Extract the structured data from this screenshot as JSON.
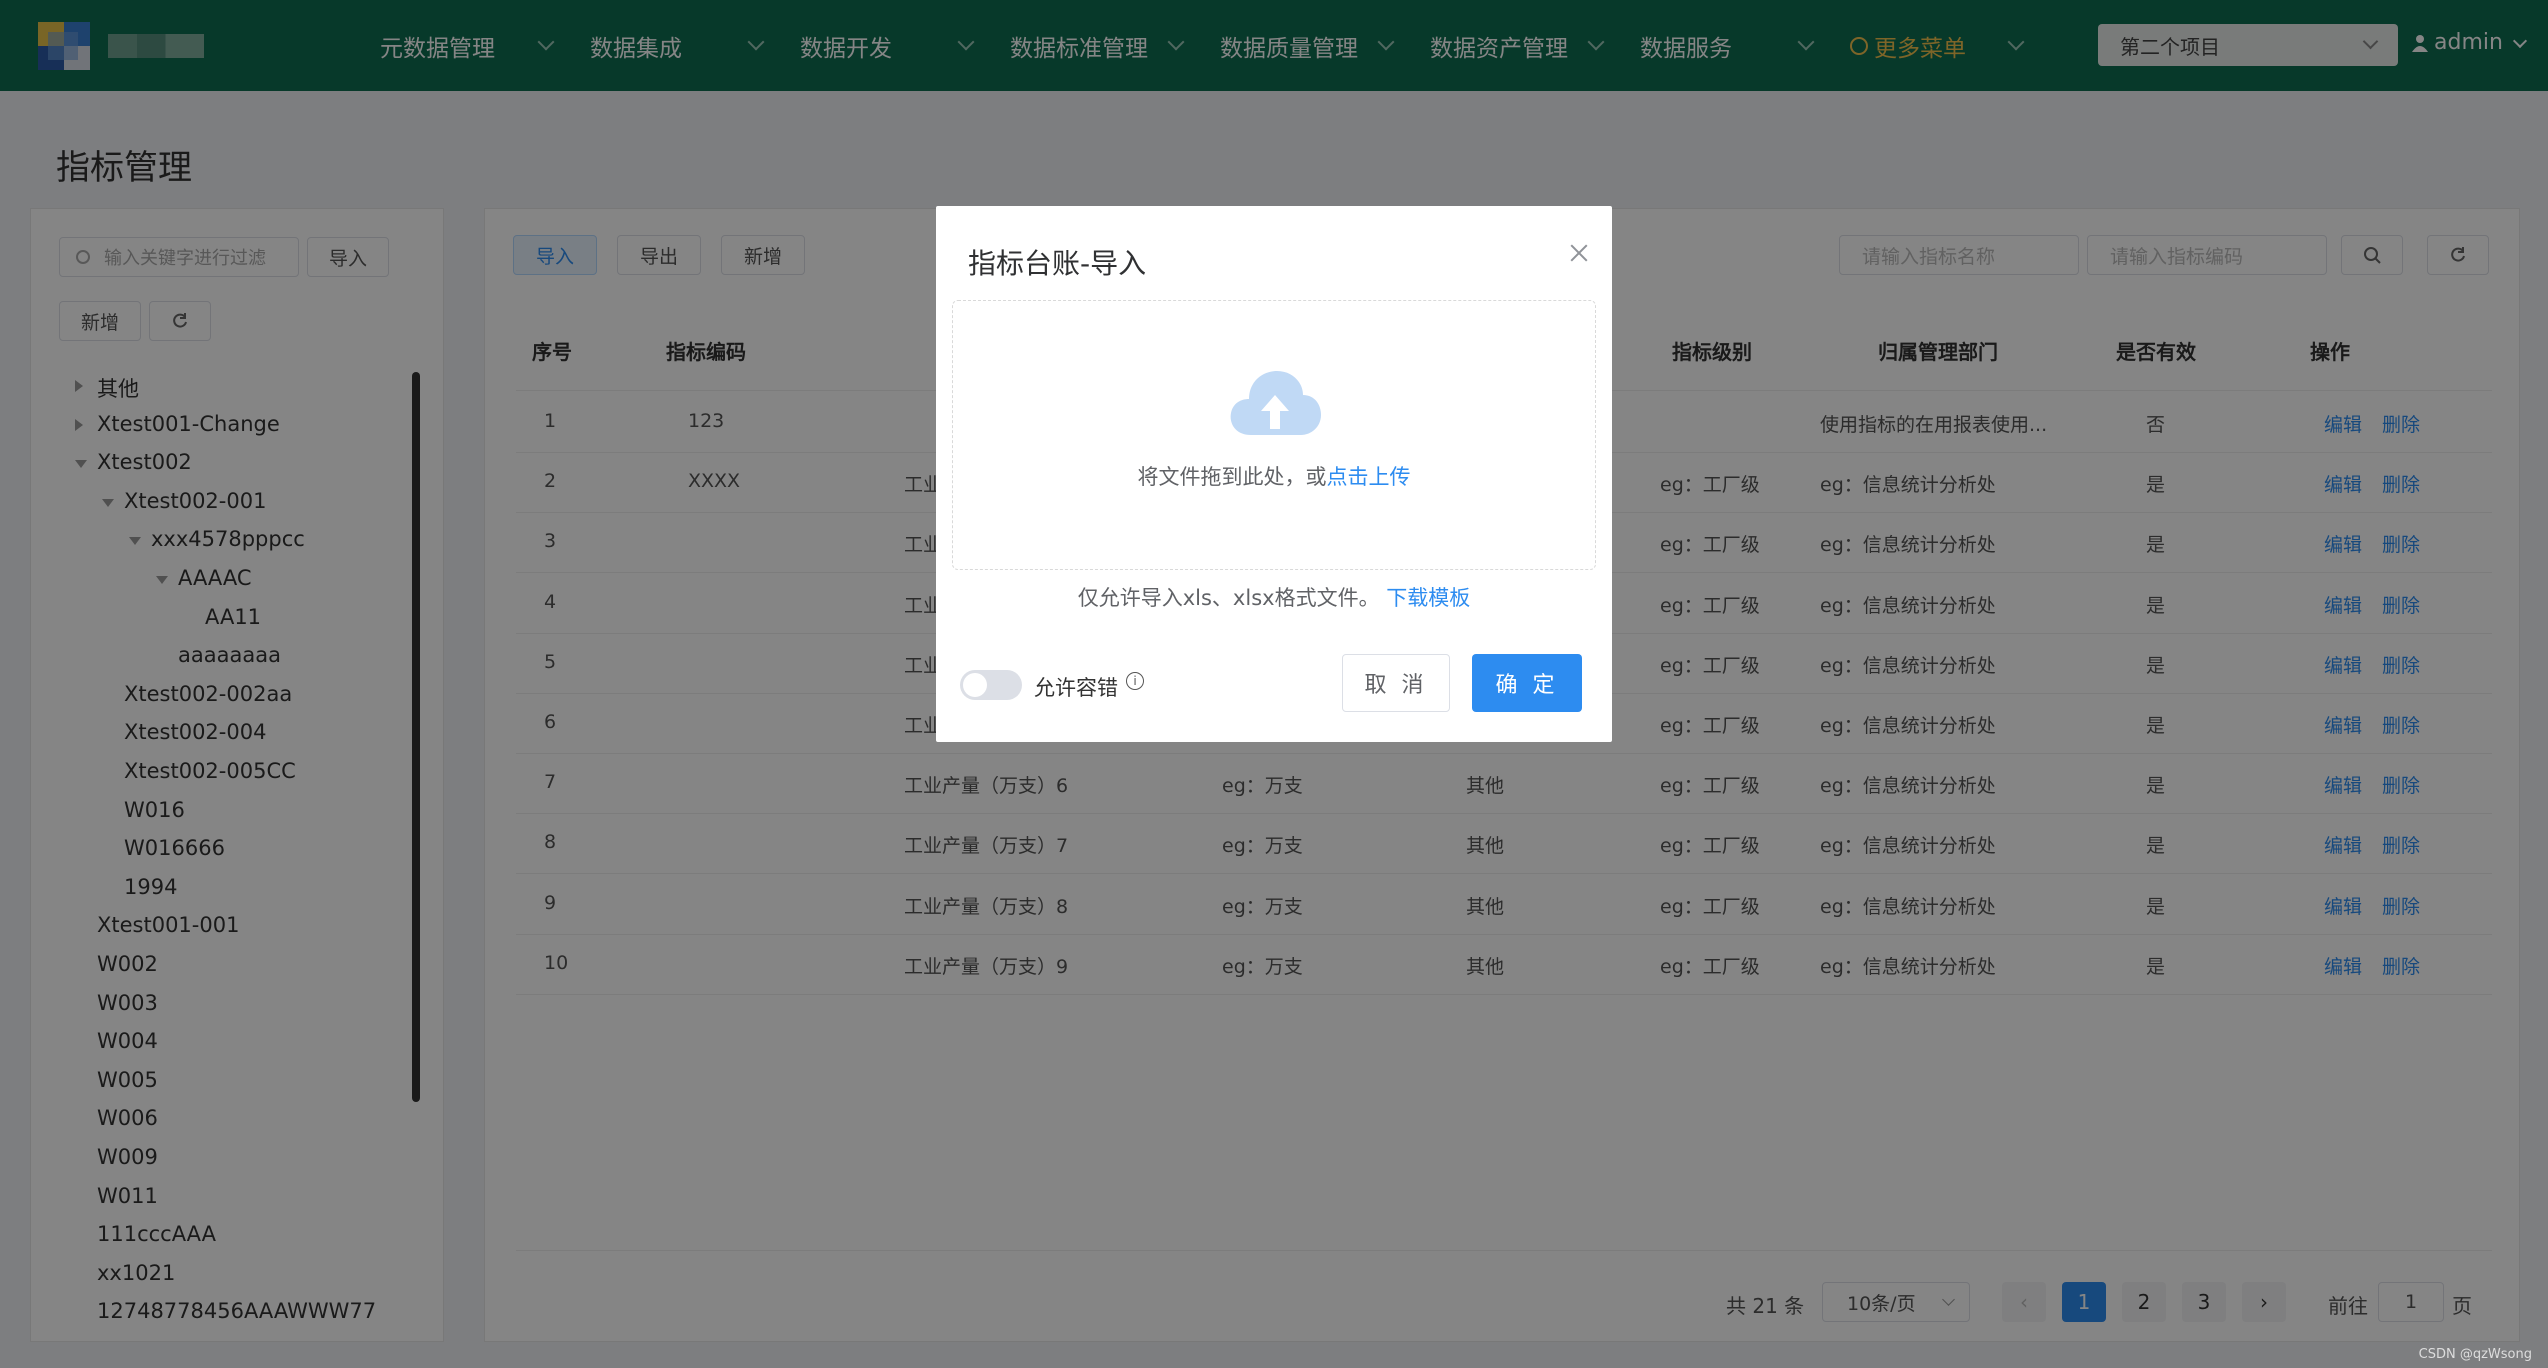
{
  "topbar": {
    "nav": [
      "元数据管理",
      "数据集成",
      "数据开发",
      "数据标准管理",
      "数据质量管理",
      "数据资产管理",
      "数据服务",
      "更多菜单"
    ],
    "project": "第二个项目",
    "user": "admin"
  },
  "page": {
    "title": "指标管理"
  },
  "left": {
    "search_placeholder": "输入关键字进行过滤",
    "import_label": "导入",
    "add_label": "新增",
    "tree": [
      {
        "label": "其他",
        "level": 0,
        "toggle": "collapsed"
      },
      {
        "label": "Xtest001-Change",
        "level": 0,
        "toggle": "collapsed"
      },
      {
        "label": "Xtest002",
        "level": 0,
        "toggle": "expanded"
      },
      {
        "label": "Xtest002-001",
        "level": 1,
        "toggle": "expanded"
      },
      {
        "label": "xxx4578pppcc",
        "level": 2,
        "toggle": "expanded"
      },
      {
        "label": "AAAAC",
        "level": 3,
        "toggle": "expanded"
      },
      {
        "label": "AA11",
        "level": 4,
        "toggle": "none"
      },
      {
        "label": "aaaaaaaa",
        "level": 3,
        "toggle": "none"
      },
      {
        "label": "Xtest002-002aa",
        "level": 1,
        "toggle": "none"
      },
      {
        "label": "Xtest002-004",
        "level": 1,
        "toggle": "none"
      },
      {
        "label": "Xtest002-005CC",
        "level": 1,
        "toggle": "none"
      },
      {
        "label": "W016",
        "level": 1,
        "toggle": "none"
      },
      {
        "label": "W016666",
        "level": 1,
        "toggle": "none"
      },
      {
        "label": "1994",
        "level": 1,
        "toggle": "none"
      },
      {
        "label": "Xtest001-001",
        "level": 0,
        "toggle": "none"
      },
      {
        "label": "W002",
        "level": 0,
        "toggle": "none"
      },
      {
        "label": "W003",
        "level": 0,
        "toggle": "none"
      },
      {
        "label": "W004",
        "level": 0,
        "toggle": "none"
      },
      {
        "label": "W005",
        "level": 0,
        "toggle": "none"
      },
      {
        "label": "W006",
        "level": 0,
        "toggle": "none"
      },
      {
        "label": "W009",
        "level": 0,
        "toggle": "none"
      },
      {
        "label": "W011",
        "level": 0,
        "toggle": "none"
      },
      {
        "label": "111cccAAA",
        "level": 0,
        "toggle": "none"
      },
      {
        "label": "xx1021",
        "level": 0,
        "toggle": "none"
      },
      {
        "label": "12748778456AAAWWW77",
        "level": 0,
        "toggle": "none"
      }
    ]
  },
  "main": {
    "toolbar": {
      "import": "导入",
      "export": "导出",
      "add": "新增"
    },
    "search1_placeholder": "请输入指标名称",
    "search2_placeholder": "请输入指标编码",
    "columns": [
      "序号",
      "指标编码",
      "指标级别",
      "归属管理部门",
      "是否有效",
      "操作"
    ],
    "edit_label": "编辑",
    "delete_label": "删除",
    "rows": [
      {
        "no": "1",
        "code": "123",
        "name": "",
        "unit": "",
        "type": "",
        "level": "",
        "dept": "使用指标的在用报表使用...",
        "valid": "否"
      },
      {
        "no": "2",
        "code": "XXXX",
        "name": "工业",
        "unit": "",
        "type": "",
        "level": "eg：工厂级",
        "dept": "eg：信息统计分析处",
        "valid": "是"
      },
      {
        "no": "3",
        "code": "",
        "name": "工业",
        "unit": "",
        "type": "",
        "level": "eg：工厂级",
        "dept": "eg：信息统计分析处",
        "valid": "是"
      },
      {
        "no": "4",
        "code": "",
        "name": "工业",
        "unit": "",
        "type": "",
        "level": "eg：工厂级",
        "dept": "eg：信息统计分析处",
        "valid": "是"
      },
      {
        "no": "5",
        "code": "",
        "name": "工业",
        "unit": "",
        "type": "",
        "level": "eg：工厂级",
        "dept": "eg：信息统计分析处",
        "valid": "是"
      },
      {
        "no": "6",
        "code": "",
        "name": "工业",
        "unit": "",
        "type": "",
        "level": "eg：工厂级",
        "dept": "eg：信息统计分析处",
        "valid": "是"
      },
      {
        "no": "7",
        "code": "",
        "name": "工业产量（万支）6",
        "unit": "eg：万支",
        "type": "其他",
        "level": "eg：工厂级",
        "dept": "eg：信息统计分析处",
        "valid": "是"
      },
      {
        "no": "8",
        "code": "",
        "name": "工业产量（万支）7",
        "unit": "eg：万支",
        "type": "其他",
        "level": "eg：工厂级",
        "dept": "eg：信息统计分析处",
        "valid": "是"
      },
      {
        "no": "9",
        "code": "",
        "name": "工业产量（万支）8",
        "unit": "eg：万支",
        "type": "其他",
        "level": "eg：工厂级",
        "dept": "eg：信息统计分析处",
        "valid": "是"
      },
      {
        "no": "10",
        "code": "",
        "name": "工业产量（万支）9",
        "unit": "eg：万支",
        "type": "其他",
        "level": "eg：工厂级",
        "dept": "eg：信息统计分析处",
        "valid": "是"
      }
    ],
    "pager": {
      "total": "共 21 条",
      "page_size": "10条/页",
      "pages": [
        "1",
        "2",
        "3"
      ],
      "goto_label": "前往",
      "goto_value": "1",
      "goto_suffix": "页"
    }
  },
  "dialog": {
    "title": "指标台账-导入",
    "drop_text": "将文件拖到此处，或",
    "upload_link": "点击上传",
    "tip_text": "仅允许导入xls、xlsx格式文件。",
    "template_link": "下载模板",
    "allow_error_label": "允许容错",
    "allow_error_on": false,
    "cancel": "取 消",
    "ok": "确 定"
  },
  "watermark": "CSDN @qzWsong",
  "colors": {
    "topbar": "#0e6e52",
    "primary": "#2d8cf0",
    "more_menu": "#f2c14e"
  }
}
